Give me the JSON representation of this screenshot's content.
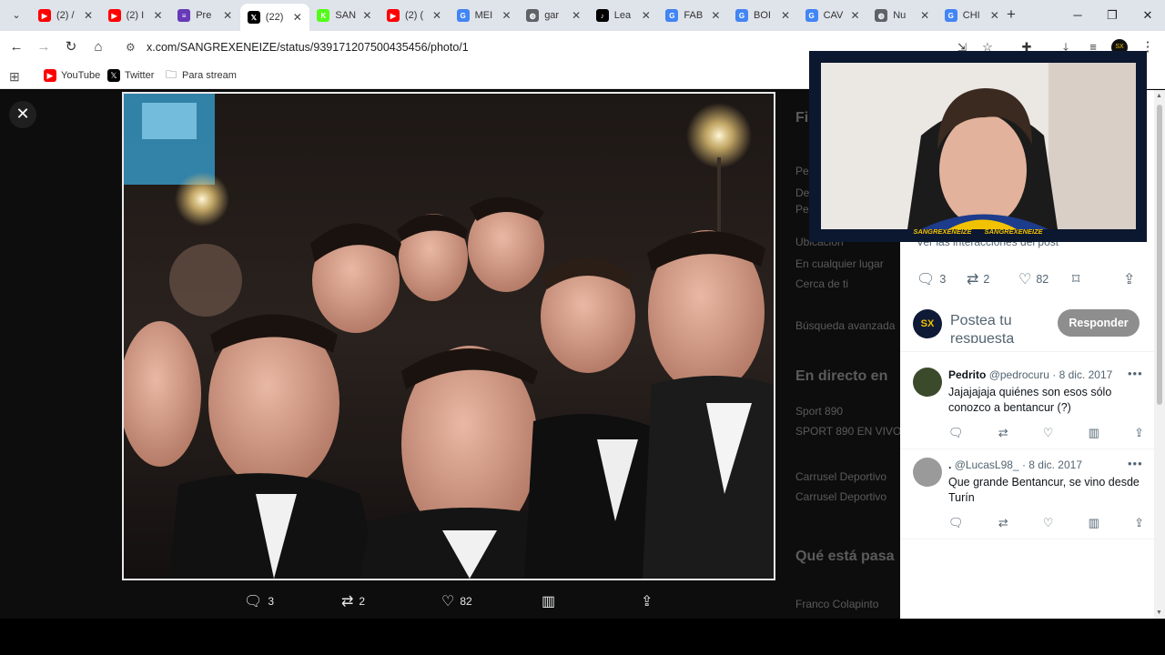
{
  "browser": {
    "tabs": [
      {
        "title": "(2) /",
        "favicon": "youtube-icon",
        "color": "#ff0000",
        "glyph": "▶"
      },
      {
        "title": "(2) I",
        "favicon": "youtube-icon",
        "color": "#ff0000",
        "glyph": "▶"
      },
      {
        "title": "Pre",
        "favicon": "forms-icon",
        "color": "#673ab7",
        "glyph": "≡"
      },
      {
        "title": "(22)",
        "favicon": "x-icon",
        "color": "#000000",
        "glyph": "𝕏",
        "active": true
      },
      {
        "title": "SAN",
        "favicon": "kick-icon",
        "color": "#53fc18",
        "glyph": "K"
      },
      {
        "title": "(2) (",
        "favicon": "youtube-icon",
        "color": "#ff0000",
        "glyph": "▶"
      },
      {
        "title": "MEI",
        "favicon": "google-icon",
        "color": "#4285f4",
        "glyph": "G"
      },
      {
        "title": "gar",
        "favicon": "globe-icon",
        "color": "#5f6368",
        "glyph": "◍"
      },
      {
        "title": "Lea",
        "favicon": "tiktok-icon",
        "color": "#000000",
        "glyph": "♪"
      },
      {
        "title": "FAB",
        "favicon": "google-icon",
        "color": "#4285f4",
        "glyph": "G"
      },
      {
        "title": "BOI",
        "favicon": "google-icon",
        "color": "#4285f4",
        "glyph": "G"
      },
      {
        "title": "CAV",
        "favicon": "google-icon",
        "color": "#4285f4",
        "glyph": "G"
      },
      {
        "title": "Nu",
        "favicon": "globe-icon",
        "color": "#5f6368",
        "glyph": "◍"
      },
      {
        "title": "CHI",
        "favicon": "google-icon",
        "color": "#4285f4",
        "glyph": "G"
      }
    ],
    "url": "x.com/SANGREXENEIZE/status/939171207500435456/photo/1",
    "bookmarks": [
      {
        "label": "YouTube",
        "icon": "youtube-icon",
        "color": "#ff0000",
        "glyph": "▶"
      },
      {
        "label": "Twitter",
        "icon": "x-icon",
        "color": "#000000",
        "glyph": "𝕏"
      },
      {
        "label": "Para stream",
        "icon": "folder-icon",
        "color": "#ffffff",
        "glyph": "🗀"
      }
    ]
  },
  "photo_viewer": {
    "actions": {
      "replies": "3",
      "reposts": "2",
      "likes": "82"
    }
  },
  "webcam": {
    "handles": [
      "SANGREXENEIZE",
      "SANGREXENEIZE"
    ]
  },
  "sidebar": {
    "interactions_link": "Ver las interacciones del post",
    "stats": {
      "replies": "3",
      "reposts": "2",
      "likes": "82"
    },
    "reply_placeholder": "Postea tu respuesta",
    "reply_button": "Responder",
    "replies": [
      {
        "name": "Pedrito",
        "handle": "@pedrocuru",
        "date": "8 dic. 2017",
        "text": "Jajajajaja quiénes son esos sólo conozco a bentancur (?)"
      },
      {
        "name": ".",
        "handle": "@LucasL98_",
        "date": "8 dic. 2017",
        "text": "Que grande Bentancur, se vino desde Turín"
      }
    ]
  },
  "background_column": {
    "items": [
      "Fil",
      "Pe",
      "De",
      "Pe",
      "Ubicación",
      "En cualquier lugar",
      "Cerca de ti",
      "Búsqueda avanzada",
      "En directo en",
      "Sport 890",
      "SPORT 890 EN VIVO",
      "Carrusel Deportivo",
      "Carrusel Deportivo",
      "Qué está pasa",
      "Franco Colapinto"
    ]
  }
}
